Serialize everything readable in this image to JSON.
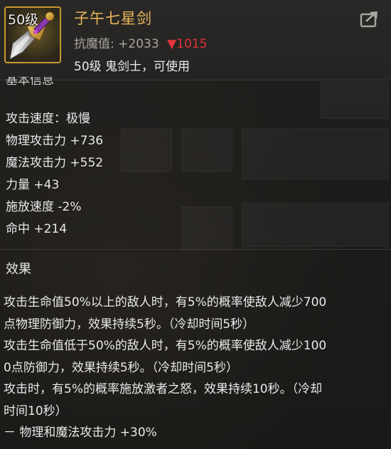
{
  "item": {
    "level_badge": "50级",
    "name": "子午七星剑",
    "resist_label": "抗魔值:",
    "resist_value": "+2033",
    "resist_change_arrow": "▼",
    "resist_change_value": "1015",
    "requirement": "50级 鬼剑士，可使用",
    "icon": "sword-icon",
    "share_icon": "share-icon"
  },
  "sections": {
    "basic_info_cut": "基本信息",
    "effect_title": "效果"
  },
  "stats": [
    "攻击速度：极慢",
    "物理攻击力 +736",
    "魔法攻击力 +552",
    "力量 +43",
    "施放速度 -2%",
    "命中 +214"
  ],
  "effects": [
    "攻击生命值50%以上的敌人时，有5%的概率使敌人减少700",
    "点物理防御力，效果持续5秒。（冷却时间5秒）",
    "攻击生命值低于50%的敌人时，有5%的概率使敌人减少100",
    "0点防御力，效果持续5秒。（冷却时间5秒）",
    "攻击时，有5%的概率施放激者之怒，效果持续10秒。（冷却",
    "时间10秒）",
    "－ 物理和魔法攻击力 +30%"
  ],
  "colors": {
    "item_name": "#e8b55a",
    "down_arrow": "#e2333a",
    "icon_border": "#c69a2e"
  }
}
